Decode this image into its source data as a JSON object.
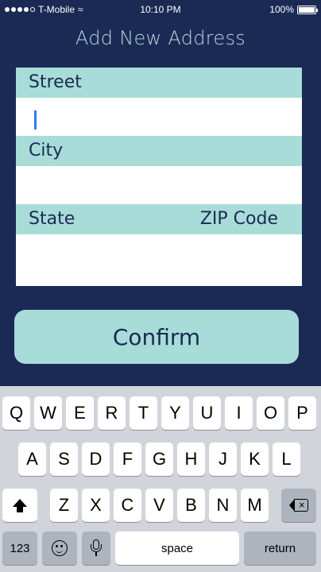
{
  "status_bar": {
    "carrier": "T-Mobile",
    "time": "10:10 PM",
    "battery_text": "100%",
    "battery_level": 1.0,
    "signal_bars_filled": 4,
    "signal_bars_total": 5
  },
  "screen": {
    "title": "Add New Address"
  },
  "form": {
    "street_label": "Street",
    "street_value": "",
    "city_label": "City",
    "city_value": "",
    "state_label": "State",
    "state_value": "",
    "zip_label": "ZIP Code",
    "zip_value": ""
  },
  "confirm_label": "Confirm",
  "keyboard": {
    "row1": [
      "Q",
      "W",
      "E",
      "R",
      "T",
      "Y",
      "U",
      "I",
      "O",
      "P"
    ],
    "row2": [
      "A",
      "S",
      "D",
      "F",
      "G",
      "H",
      "J",
      "K",
      "L"
    ],
    "row3": [
      "Z",
      "X",
      "C",
      "V",
      "B",
      "N",
      "M"
    ],
    "numbers_label": "123",
    "space_label": "space",
    "return_label": "return"
  },
  "colors": {
    "background": "#1a2a55",
    "accent": "#a8dcd8",
    "caret": "#2f7cf6"
  }
}
